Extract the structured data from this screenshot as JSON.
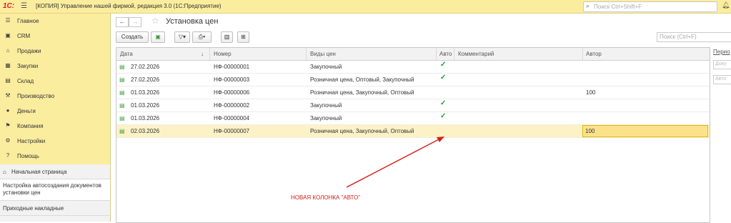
{
  "topbar": {
    "logo": "1С:",
    "app_title": "[КОПИЯ] Управление нашей фирмой, редакция 3.0  (1С:Предприятие)",
    "search_placeholder": "Поиск Ctrl+Shift+F"
  },
  "sidebar": {
    "items": [
      {
        "label": "Главное",
        "icon": "menu-icon"
      },
      {
        "label": "CRM",
        "icon": "crm-icon"
      },
      {
        "label": "Продажи",
        "icon": "sales-icon"
      },
      {
        "label": "Закупки",
        "icon": "purchases-icon"
      },
      {
        "label": "Склад",
        "icon": "warehouse-icon"
      },
      {
        "label": "Производство",
        "icon": "factory-icon"
      },
      {
        "label": "Деньги",
        "icon": "money-icon"
      },
      {
        "label": "Компания",
        "icon": "flag-icon"
      },
      {
        "label": "Настройки",
        "icon": "gear-icon"
      },
      {
        "label": "Помощь",
        "icon": "help-icon"
      }
    ],
    "quick": {
      "home": "Начальная страница",
      "autocreate": "Настройка автосоздания документов установки цен",
      "incoming": "Приходные накладные"
    }
  },
  "main": {
    "title": "Установка цен",
    "toolbar": {
      "create": "Создать"
    },
    "search_placeholder": "Поиск (Ctrl+F)",
    "columns": {
      "date": "Дата",
      "number": "Номер",
      "price_types": "Виды цен",
      "auto": "Авто",
      "comment": "Комментарий",
      "author": "Автор"
    },
    "rows": [
      {
        "date": "27.02.2026",
        "number": "НФ-00000001",
        "price_types": "Закупочный",
        "auto": true,
        "comment": "",
        "author": ""
      },
      {
        "date": "27.02.2026",
        "number": "НФ-00000003",
        "price_types": "Розничная цена, Оптовый, Закупочный",
        "auto": true,
        "comment": "",
        "author": ""
      },
      {
        "date": "01.03.2026",
        "number": "НФ-00000006",
        "price_types": "Розничная цена, Закупочный, Оптовый",
        "auto": false,
        "comment": "",
        "author": "100"
      },
      {
        "date": "01.03.2026",
        "number": "НФ-00000002",
        "price_types": "Закупочный",
        "auto": true,
        "comment": "",
        "author": ""
      },
      {
        "date": "01.03.2026",
        "number": "НФ-00000004",
        "price_types": "Закупочный",
        "auto": true,
        "comment": "",
        "author": ""
      },
      {
        "date": "02.03.2026",
        "number": "НФ-00000007",
        "price_types": "Розничная цена, Закупочный, Оптовый",
        "auto": false,
        "comment": "",
        "author": "100",
        "selected": true
      }
    ]
  },
  "right_panel": {
    "label": "Перио",
    "field1": "Доку",
    "field2": "Авто"
  },
  "annotation": {
    "text": "НОВАЯ КОЛОНКА \"АВТО\"",
    "color": "#d4201c"
  },
  "colors": {
    "brand_yellow": "#fbed9e",
    "selected_row": "#fcf2c6",
    "check_green": "#1f9d3a"
  }
}
